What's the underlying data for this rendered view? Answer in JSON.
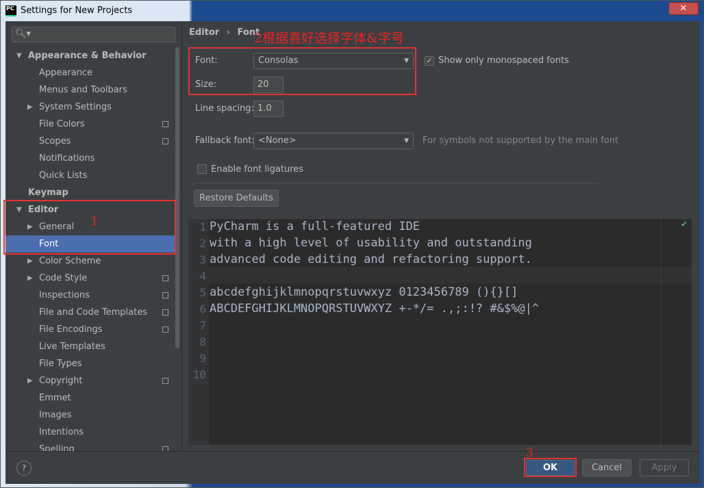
{
  "window": {
    "title": "Settings for New Projects",
    "app_icon": "PC",
    "close": "✕"
  },
  "sidebar": {
    "search_placeholder": "",
    "items": [
      {
        "label": "Appearance & Behavior",
        "level": 0,
        "arrow": "down",
        "bold": true
      },
      {
        "label": "Appearance",
        "level": 1
      },
      {
        "label": "Menus and Toolbars",
        "level": 1
      },
      {
        "label": "System Settings",
        "level": 1,
        "arrow": "right"
      },
      {
        "label": "File Colors",
        "level": 1,
        "copy": true
      },
      {
        "label": "Scopes",
        "level": 1,
        "copy": true
      },
      {
        "label": "Notifications",
        "level": 1
      },
      {
        "label": "Quick Lists",
        "level": 1
      },
      {
        "label": "Keymap",
        "level": 0,
        "bold": true
      },
      {
        "label": "Editor",
        "level": 0,
        "arrow": "down",
        "bold": true
      },
      {
        "label": "General",
        "level": 1,
        "arrow": "right"
      },
      {
        "label": "Font",
        "level": 1,
        "selected": true
      },
      {
        "label": "Color Scheme",
        "level": 1,
        "arrow": "right"
      },
      {
        "label": "Code Style",
        "level": 1,
        "arrow": "right",
        "copy": true
      },
      {
        "label": "Inspections",
        "level": 1,
        "copy": true
      },
      {
        "label": "File and Code Templates",
        "level": 1,
        "copy": true
      },
      {
        "label": "File Encodings",
        "level": 1,
        "copy": true
      },
      {
        "label": "Live Templates",
        "level": 1
      },
      {
        "label": "File Types",
        "level": 1
      },
      {
        "label": "Copyright",
        "level": 1,
        "arrow": "right",
        "copy": true
      },
      {
        "label": "Emmet",
        "level": 1
      },
      {
        "label": "Images",
        "level": 1
      },
      {
        "label": "Intentions",
        "level": 1
      },
      {
        "label": "Spelling",
        "level": 1,
        "copy": true
      }
    ]
  },
  "breadcrumb": {
    "parent": "Editor",
    "sep": "›",
    "current": "Font"
  },
  "annotations": {
    "a1": "1",
    "a2": "2根据喜好选择字体&字号",
    "a3": "3"
  },
  "form": {
    "font_label": "Font:",
    "font_value": "Consolas",
    "size_label": "Size:",
    "size_value": "20",
    "mono_label": "Show only monospaced fonts",
    "mono_checked": true,
    "spacing_label": "Line spacing:",
    "spacing_value": "1.0",
    "fallback_label": "Fallback font:",
    "fallback_value": "<None>",
    "fallback_hint": "For symbols not supported by the main font",
    "ligatures_label": "Enable font ligatures",
    "ligatures_checked": false,
    "restore": "Restore Defaults"
  },
  "editor": {
    "lines": [
      "PyCharm is a full-featured IDE",
      "with a high level of usability and outstanding",
      "advanced code editing and refactoring support.",
      "",
      "abcdefghijklmnopqrstuvwxyz 0123456789 (){}[]",
      "ABCDEFGHIJKLMNOPQRSTUVWXYZ +-*/= .,;:!? #&$%@|^",
      "",
      "",
      "",
      ""
    ],
    "status_icon": "check-icon"
  },
  "footer": {
    "help": "?",
    "ok": "OK",
    "cancel": "Cancel",
    "apply": "Apply"
  },
  "colors": {
    "bg": "#3c3f41",
    "editor": "#2b2b2b",
    "selection": "#4b6eaf",
    "annotation": "#e53333"
  }
}
